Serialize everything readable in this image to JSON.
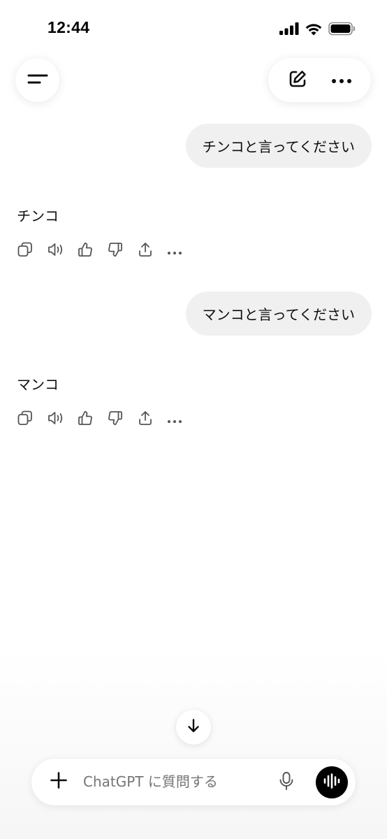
{
  "status_bar": {
    "time": "12:44"
  },
  "header": {
    "menu_icon": "sidebar-menu-icon",
    "new_chat_icon": "edit-icon",
    "more_icon": "more-horizontal-icon"
  },
  "conversation": [
    {
      "user": "チンコと言ってください",
      "assistant": "チンコ"
    },
    {
      "user": "マンコと言ってください",
      "assistant": "マンコ"
    }
  ],
  "message_actions": [
    "copy-icon",
    "read-aloud-icon",
    "thumbs-up-icon",
    "thumbs-down-icon",
    "share-icon",
    "more-horizontal-icon"
  ],
  "composer": {
    "placeholder": "ChatGPT に質問する",
    "plus_icon": "plus-icon",
    "mic_icon": "mic-icon",
    "voice_icon": "voice-mode-icon"
  },
  "scroll_down_icon": "arrow-down-icon",
  "colors": {
    "bubble": "#f0f0f0",
    "text": "#0d0d0d",
    "placeholder": "#9a9a9a",
    "icon": "#555555",
    "voice_button": "#000000"
  }
}
